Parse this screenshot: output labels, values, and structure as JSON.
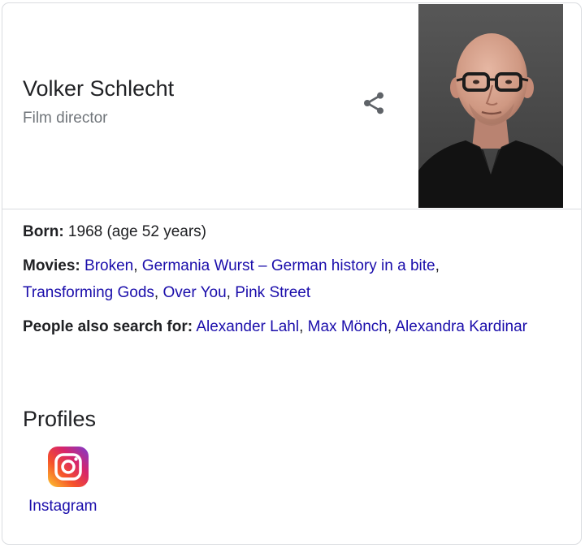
{
  "header": {
    "title": "Volker Schlecht",
    "subtitle": "Film director",
    "share_icon": "share-icon",
    "photo": "portrait-photo"
  },
  "facts": {
    "born": {
      "label": "Born:",
      "value": " 1968 (age 52 years)"
    },
    "movies": {
      "label": "Movies:",
      "items": [
        "Broken",
        "Germania Wurst – German history in a bite",
        "Transforming Gods",
        "Over You",
        "Pink Street"
      ]
    },
    "people": {
      "label": "People also search for:",
      "items": [
        "Alexander Lahl",
        "Max Mönch",
        "Alexandra Kardinar"
      ]
    }
  },
  "profiles": {
    "title": "Profiles",
    "items": [
      {
        "label": "Instagram",
        "icon": "instagram-icon"
      }
    ]
  },
  "colors": {
    "link": "#1a0dab",
    "text": "#202124",
    "secondary": "#70757a",
    "border": "#dadce0"
  }
}
